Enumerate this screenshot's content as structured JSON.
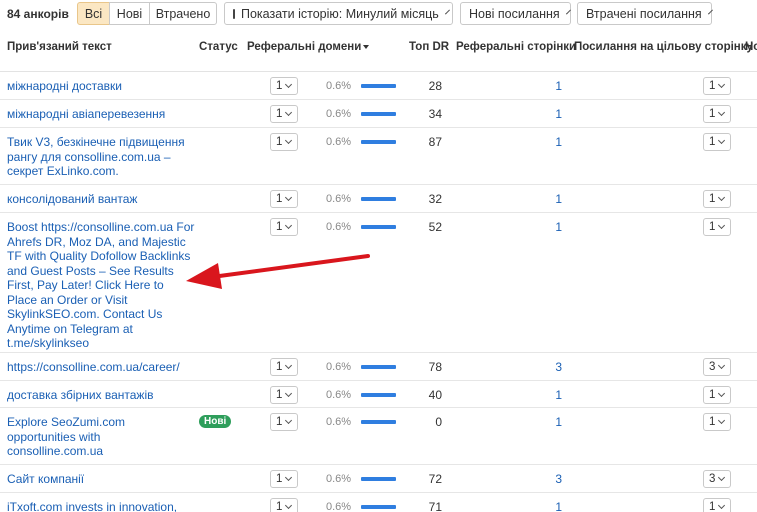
{
  "toolbar": {
    "count": "84 анкорів",
    "filter_all": "Всі",
    "filter_new": "Нові",
    "filter_lost": "Втрачено",
    "history_label": "Показати історію: Минулий місяць",
    "new_links_label": "Нові посилання",
    "lost_links_label": "Втрачені посилання"
  },
  "columns": {
    "anchor": "Прив'язаний текст",
    "status": "Статус",
    "ref_domains": "Реферальні домени",
    "top_dr": "Топ DR",
    "ref_pages": "Реферальні сторінки",
    "target_links": "Посилання на цільову сторінку",
    "extra": "Но"
  },
  "rows": [
    {
      "anchor": "міжнародні доставки",
      "status": "",
      "ref_domains": "1",
      "share": "0.6%",
      "share_value": 0.6,
      "top_dr": "28",
      "ref_pages": "1",
      "target_links": "1"
    },
    {
      "anchor": "міжнародні авіаперевезення",
      "status": "",
      "ref_domains": "1",
      "share": "0.6%",
      "share_value": 0.6,
      "top_dr": "34",
      "ref_pages": "1",
      "target_links": "1"
    },
    {
      "anchor": "Твик V3, безкінечне підвищення рангу для consolline.com.ua – секрет ExLinko.com.",
      "status": "",
      "ref_domains": "1",
      "share": "0.6%",
      "share_value": 0.6,
      "top_dr": "87",
      "ref_pages": "1",
      "target_links": "1"
    },
    {
      "anchor": "консолідований вантаж",
      "status": "",
      "ref_domains": "1",
      "share": "0.6%",
      "share_value": 0.6,
      "top_dr": "32",
      "ref_pages": "1",
      "target_links": "1"
    },
    {
      "anchor": "Boost https://consolline.com.ua For Ahrefs DR, Moz DA, and Majestic TF with Quality Dofollow Backlinks and Guest Posts – See Results First, Pay Later! Click Here to Place an Order or Visit SkylinkSEO.com. Contact Us Anytime on Telegram at t.me/skylinkseo",
      "status": "",
      "ref_domains": "1",
      "share": "0.6%",
      "share_value": 0.6,
      "top_dr": "52",
      "ref_pages": "1",
      "target_links": "1"
    },
    {
      "anchor": "https://consolline.com.ua/career/",
      "status": "",
      "ref_domains": "1",
      "share": "0.6%",
      "share_value": 0.6,
      "top_dr": "78",
      "ref_pages": "3",
      "target_links": "3"
    },
    {
      "anchor": "доставка збірних вантажів",
      "status": "",
      "ref_domains": "1",
      "share": "0.6%",
      "share_value": 0.6,
      "top_dr": "40",
      "ref_pages": "1",
      "target_links": "1"
    },
    {
      "anchor": "Explore SeoZumi.com opportunities with consolline.com.ua",
      "status": "Нові",
      "ref_domains": "1",
      "share": "0.6%",
      "share_value": 0.6,
      "top_dr": "0",
      "ref_pages": "1",
      "target_links": "1"
    },
    {
      "anchor": "Сайт компанії",
      "status": "",
      "ref_domains": "1",
      "share": "0.6%",
      "share_value": 0.6,
      "top_dr": "72",
      "ref_pages": "3",
      "target_links": "3"
    },
    {
      "anchor": "iTxoft.com invests in innovation,",
      "status": "",
      "ref_domains": "1",
      "share": "0.6%",
      "share_value": 0.6,
      "top_dr": "71",
      "ref_pages": "1",
      "target_links": "1"
    }
  ],
  "colors": {
    "accent_filter": "#fbe7c3",
    "link": "#1a5fb4",
    "bar": "#2f7ee0",
    "badge_new": "#2e9e5b",
    "annotation_arrow": "#d9161d"
  }
}
